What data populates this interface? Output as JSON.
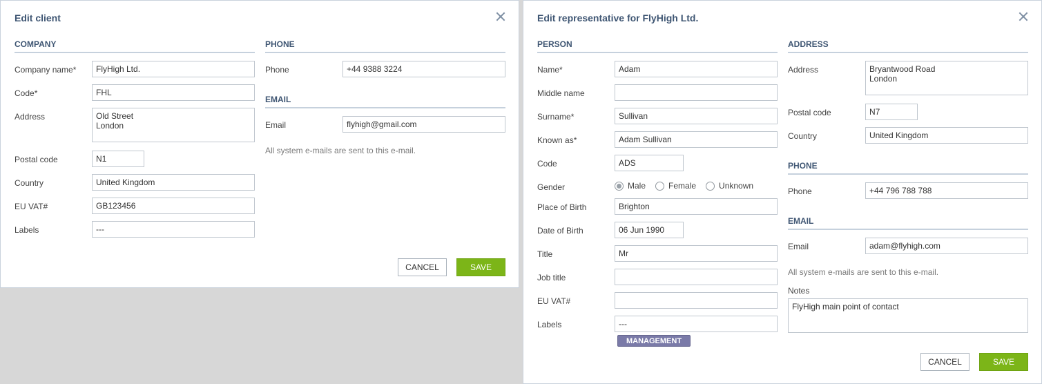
{
  "client_dialog": {
    "title": "Edit client",
    "company_section": "COMPANY",
    "phone_section": "PHONE",
    "email_section": "EMAIL",
    "fields": {
      "company_name": {
        "label": "Company name*",
        "value": "FlyHigh Ltd."
      },
      "code": {
        "label": "Code*",
        "value": "FHL"
      },
      "address": {
        "label": "Address",
        "value": "Old Street\nLondon"
      },
      "postal_code": {
        "label": "Postal code",
        "value": "N1"
      },
      "country": {
        "label": "Country",
        "value": "United Kingdom"
      },
      "eu_vat": {
        "label": "EU VAT#",
        "value": "GB123456"
      },
      "labels": {
        "label": "Labels",
        "value": "---"
      },
      "phone": {
        "label": "Phone",
        "value": "+44 9388 3224"
      },
      "email": {
        "label": "Email",
        "value": "flyhigh@gmail.com"
      }
    },
    "email_hint": "All system e-mails are sent to this e-mail.",
    "cancel_label": "CANCEL",
    "save_label": "SAVE"
  },
  "rep_dialog": {
    "title": "Edit representative for FlyHigh Ltd.",
    "person_section": "PERSON",
    "address_section": "ADDRESS",
    "phone_section": "PHONE",
    "email_section": "EMAIL",
    "fields": {
      "name": {
        "label": "Name*",
        "value": "Adam"
      },
      "middle_name": {
        "label": "Middle name",
        "value": ""
      },
      "surname": {
        "label": "Surname*",
        "value": "Sullivan"
      },
      "known_as": {
        "label": "Known as*",
        "value": "Adam Sullivan"
      },
      "code": {
        "label": "Code",
        "value": "ADS"
      },
      "gender": {
        "label": "Gender",
        "options": [
          "Male",
          "Female",
          "Unknown"
        ],
        "selected": "Male"
      },
      "place_of_birth": {
        "label": "Place of Birth",
        "value": "Brighton"
      },
      "date_of_birth": {
        "label": "Date of Birth",
        "value": "06 Jun 1990"
      },
      "title": {
        "label": "Title",
        "value": "Mr"
      },
      "job_title": {
        "label": "Job title",
        "value": ""
      },
      "eu_vat": {
        "label": "EU VAT#",
        "value": ""
      },
      "labels": {
        "label": "Labels",
        "value": "---"
      },
      "address": {
        "label": "Address",
        "value": "Bryantwood Road\nLondon"
      },
      "postal_code": {
        "label": "Postal code",
        "value": "N7"
      },
      "country": {
        "label": "Country",
        "value": "United Kingdom"
      },
      "phone": {
        "label": "Phone",
        "value": "+44 796 788 788"
      },
      "email": {
        "label": "Email",
        "value": "adam@flyhigh.com"
      },
      "notes": {
        "label": "Notes",
        "value": "FlyHigh main point of contact"
      }
    },
    "label_tag": "MANAGEMENT",
    "email_hint": "All system e-mails are sent to this e-mail.",
    "cancel_label": "CANCEL",
    "save_label": "SAVE"
  },
  "colors": {
    "title": "#3f5673",
    "save_button": "#7cb518",
    "tag": "#7a7aa8",
    "backdrop": "#d7d7d7"
  }
}
